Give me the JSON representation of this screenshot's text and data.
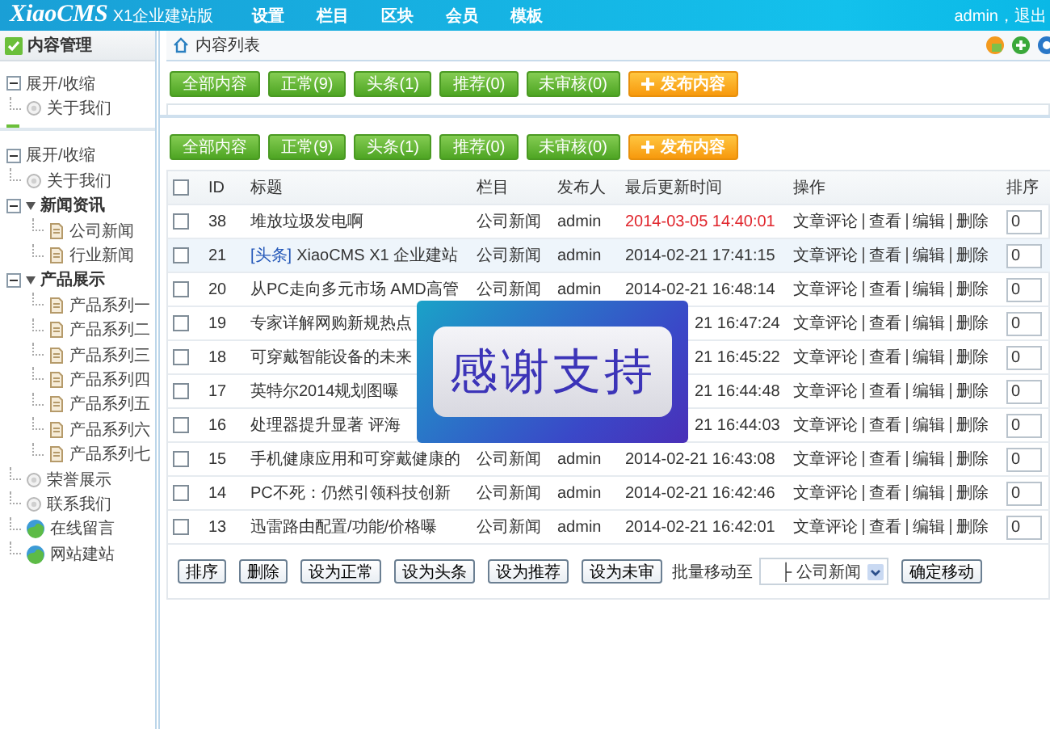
{
  "header": {
    "logo": "XiaoCMS",
    "edition": "X1企业建站版",
    "nav": [
      {
        "label": "设置",
        "selected": false
      },
      {
        "label": "栏目",
        "selected": false
      },
      {
        "label": "区块",
        "selected": false
      },
      {
        "label": "会员",
        "selected": false
      },
      {
        "label": "模板",
        "selected": false
      }
    ],
    "user": "admin，退出"
  },
  "sidebar": {
    "title": "内容管理",
    "sections": [
      {
        "toggle": "展开/收缩",
        "items": [
          {
            "label": "关于我们",
            "kind": "page"
          }
        ]
      },
      {
        "toggle": "展开/收缩",
        "items": [
          {
            "label": "关于我们",
            "kind": "page"
          },
          {
            "label": "新闻资讯",
            "kind": "category",
            "expanded": true,
            "children": [
              {
                "label": "公司新闻",
                "kind": "list"
              },
              {
                "label": "行业新闻",
                "kind": "list"
              }
            ]
          },
          {
            "label": "产品展示",
            "kind": "category",
            "expanded": true,
            "children": [
              {
                "label": "产品系列一",
                "kind": "list"
              },
              {
                "label": "产品系列二",
                "kind": "list"
              },
              {
                "label": "产品系列三",
                "kind": "list"
              },
              {
                "label": "产品系列四",
                "kind": "list"
              },
              {
                "label": "产品系列五",
                "kind": "list"
              },
              {
                "label": "产品系列六",
                "kind": "list"
              },
              {
                "label": "产品系列七",
                "kind": "list"
              }
            ]
          },
          {
            "label": "荣誉展示",
            "kind": "page"
          },
          {
            "label": "联系我们",
            "kind": "page"
          },
          {
            "label": "在线留言",
            "kind": "link"
          },
          {
            "label": "网站建站",
            "kind": "link"
          }
        ]
      }
    ]
  },
  "main": {
    "breadcrumb": "内容列表",
    "toolbars": [
      {
        "buttons": [
          {
            "label": "全部内容",
            "kind": "filter"
          },
          {
            "label": "正常(9)",
            "kind": "filter"
          },
          {
            "label": "头条(1)",
            "kind": "filter"
          },
          {
            "label": "推荐(0)",
            "kind": "filter"
          },
          {
            "label": "未审核(0)",
            "kind": "filter"
          },
          {
            "label": "发布内容",
            "kind": "add"
          }
        ]
      },
      {
        "buttons": [
          {
            "label": "全部内容",
            "kind": "filter"
          },
          {
            "label": "正常(9)",
            "kind": "filter"
          },
          {
            "label": "头条(1)",
            "kind": "filter"
          },
          {
            "label": "推荐(0)",
            "kind": "filter"
          },
          {
            "label": "未审核(0)",
            "kind": "filter"
          },
          {
            "label": "发布内容",
            "kind": "add"
          }
        ]
      }
    ],
    "table": {
      "select_all": {
        "checked": false
      },
      "columns": [
        "ID",
        "标题",
        "栏目",
        "发布人",
        "最后更新时间",
        "操作",
        "排序"
      ],
      "rows": [
        {
          "checked": false,
          "selected": false,
          "covered": false,
          "id": "38",
          "title": "堆放垃圾发电啊",
          "category": "公司新闻",
          "author": "admin",
          "time": "2014-03-05 14:40:01",
          "time_alert": true,
          "actions": [
            "文章评论",
            "查看",
            "编辑",
            "删除"
          ],
          "sort": "0"
        },
        {
          "checked": false,
          "selected": true,
          "covered": false,
          "id": "21",
          "tag": "[头条]",
          "title": "XiaoCMS X1 企业建站",
          "category": "公司新闻",
          "author": "admin",
          "time": "2014-02-21 17:41:15",
          "time_alert": false,
          "actions": [
            "文章评论",
            "查看",
            "编辑",
            "删除"
          ],
          "sort": "0"
        },
        {
          "checked": false,
          "selected": false,
          "covered": false,
          "id": "20",
          "title": "从PC走向多元市场 AMD高管",
          "category": "公司新闻",
          "author": "admin",
          "time": "2014-02-21 16:48:14",
          "time_alert": false,
          "actions": [
            "文章评论",
            "查看",
            "编辑",
            "删除"
          ],
          "sort": "0"
        },
        {
          "checked": false,
          "selected": false,
          "covered": true,
          "id": "19",
          "title": "专家详解网购新规热点",
          "time": "21 16:47:24",
          "time_alert": false,
          "actions": [
            "文章评论",
            "查看",
            "编辑",
            "删除"
          ],
          "sort": "0"
        },
        {
          "checked": false,
          "selected": false,
          "covered": true,
          "id": "18",
          "title": "可穿戴智能设备的未来",
          "time": "21 16:45:22",
          "time_alert": false,
          "actions": [
            "文章评论",
            "查看",
            "编辑",
            "删除"
          ],
          "sort": "0"
        },
        {
          "checked": false,
          "selected": false,
          "covered": true,
          "id": "17",
          "title": "英特尔2014规划图曝",
          "time": "21 16:44:48",
          "time_alert": false,
          "actions": [
            "文章评论",
            "查看",
            "编辑",
            "删除"
          ],
          "sort": "0"
        },
        {
          "checked": false,
          "selected": false,
          "covered": true,
          "id": "16",
          "title": "处理器提升显著 评海",
          "time": "21 16:44:03",
          "time_alert": false,
          "actions": [
            "文章评论",
            "查看",
            "编辑",
            "删除"
          ],
          "sort": "0"
        },
        {
          "checked": false,
          "selected": false,
          "covered": false,
          "id": "15",
          "title": "手机健康应用和可穿戴健康的",
          "category": "公司新闻",
          "author": "admin",
          "time": "2014-02-21 16:43:08",
          "time_alert": false,
          "actions": [
            "文章评论",
            "查看",
            "编辑",
            "删除"
          ],
          "sort": "0"
        },
        {
          "checked": false,
          "selected": false,
          "covered": false,
          "id": "14",
          "title": "PC不死：仍然引领科技创新",
          "category": "公司新闻",
          "author": "admin",
          "time": "2014-02-21 16:42:46",
          "time_alert": false,
          "actions": [
            "文章评论",
            "查看",
            "编辑",
            "删除"
          ],
          "sort": "0"
        },
        {
          "checked": false,
          "selected": false,
          "covered": false,
          "id": "13",
          "title": "迅雷路由配置/功能/价格曝",
          "category": "公司新闻",
          "author": "admin",
          "time": "2014-02-21 16:42:01",
          "time_alert": false,
          "actions": [
            "文章评论",
            "查看",
            "编辑",
            "删除"
          ],
          "sort": "0"
        }
      ]
    },
    "overlay": {
      "text": "感谢支持"
    },
    "batch": {
      "buttons": [
        "排序",
        "删除",
        "设为正常",
        "设为头条",
        "设为推荐",
        "设为未审"
      ],
      "move_label": "批量移动至",
      "move_target": "├ 公司新闻",
      "confirm": "确定移动"
    }
  }
}
